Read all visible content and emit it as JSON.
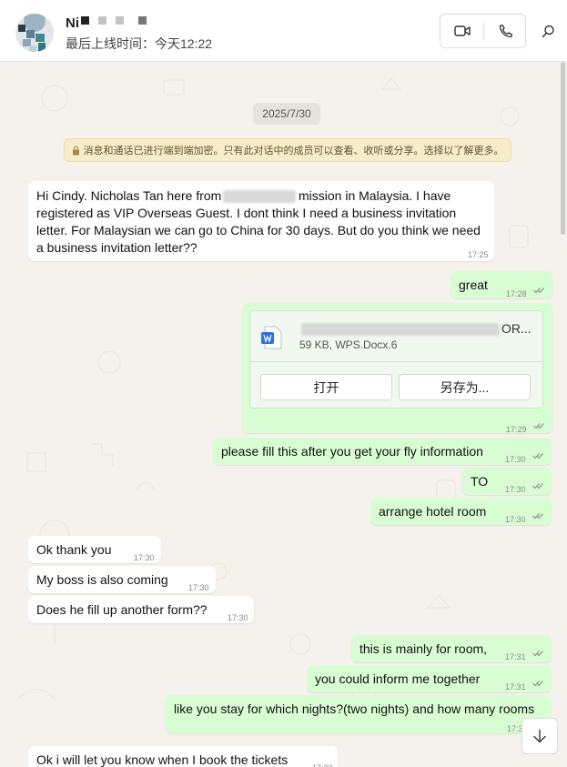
{
  "header": {
    "contact_name": "Ni",
    "last_seen": "最后上线时间：今天12:22",
    "icons": {
      "video": "video-camera-icon",
      "voice": "phone-icon",
      "search": "search-icon"
    }
  },
  "chat": {
    "date_chip": "2025/7/30",
    "encryption_notice": "消息和通话已进行端到端加密。只有此对话中的成员可以查看、收听或分享。选择以了解更多。",
    "messages": [
      {
        "direction": "in",
        "lines": [
          "Hi Cindy. Nicholas Tan here from",
          "mission in Malaysia. I have",
          "registered as VIP Overseas Guest. I dont think I need a business invitation",
          "letter. For Malaysian we can go to China for 30 days. But do you think we need",
          "a business invitation letter??"
        ],
        "time": "17:25"
      },
      {
        "direction": "out",
        "text": "great",
        "time": "17:28"
      },
      {
        "direction": "out",
        "type": "document",
        "file_name_suffix": "OR...",
        "file_meta": "59 KB, WPS.Docx.6",
        "open_label": "打开",
        "save_label": "另存为...",
        "time": "17:29"
      },
      {
        "direction": "out",
        "text": "please fill this after you get your fly information",
        "time": "17:30"
      },
      {
        "direction": "out",
        "text": "TO",
        "time": "17:30"
      },
      {
        "direction": "out",
        "text": "arrange hotel room",
        "time": "17:30"
      },
      {
        "direction": "in",
        "text": "Ok thank you",
        "time": "17:30"
      },
      {
        "direction": "in",
        "text": "My boss is also coming",
        "time": "17:30"
      },
      {
        "direction": "in",
        "text": "Does he fill up another form??",
        "time": "17:30"
      },
      {
        "direction": "out",
        "text": "this is mainly for room,",
        "time": "17:31"
      },
      {
        "direction": "out",
        "text": "you could  inform me together",
        "time": "17:31"
      },
      {
        "direction": "out",
        "text": "like you stay for which nights?(two nights) and how many rooms",
        "time": "17:3"
      },
      {
        "direction": "in",
        "text": "Ok i will let you know when I book the tickets",
        "time": "17:32"
      }
    ]
  },
  "colors": {
    "incoming_bubble": "#ffffff",
    "outgoing_bubble": "#d9fdd3",
    "chat_background": "#f5f1ec",
    "notice_background": "#f8ecc9"
  }
}
